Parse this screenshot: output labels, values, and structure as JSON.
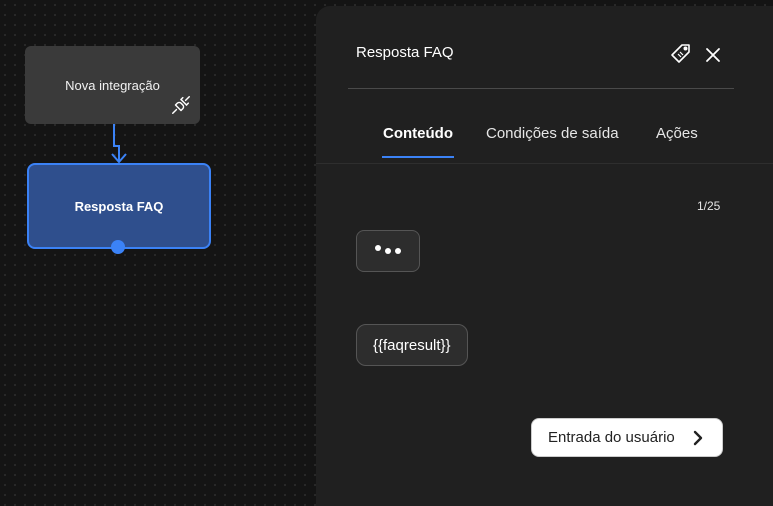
{
  "canvas": {
    "nodes": [
      {
        "label": "Nova integração",
        "icon": "plug-icon"
      },
      {
        "label": "Resposta FAQ",
        "selected": true
      }
    ],
    "accent_color": "#3b82f6",
    "node_selected_color": "#2f4f8d"
  },
  "panel": {
    "title": "Resposta FAQ",
    "tag_icon": "tag-icon",
    "close_icon": "close-icon",
    "tabs": [
      {
        "label": "Conteúdo",
        "active": true
      },
      {
        "label": "Condições de saída",
        "active": false
      },
      {
        "label": "Ações",
        "active": false
      }
    ],
    "counter": "1/25",
    "messages": [
      {
        "type": "typing",
        "icon": "typing-dots-icon"
      },
      {
        "type": "text",
        "text": "{{faqresult}}"
      }
    ],
    "user_input_button": {
      "label": "Entrada do usuário",
      "icon": "chevron-right-icon"
    }
  }
}
